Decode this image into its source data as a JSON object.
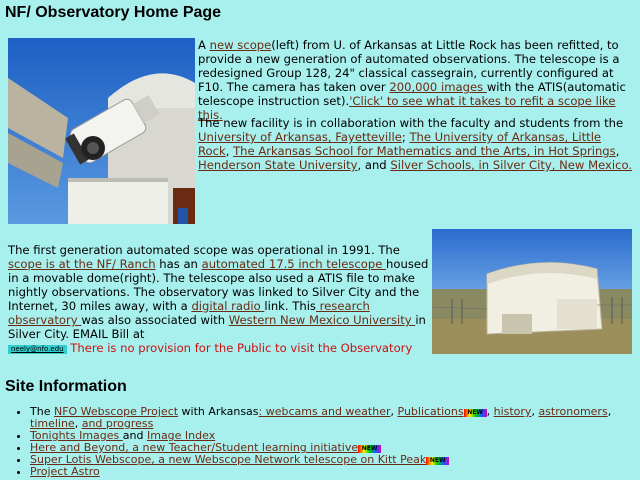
{
  "page": {
    "title": "NF/ Observatory Home Page",
    "accent": "#6b2a12",
    "background": "#a8f0ee",
    "alert_color": "#cc1111"
  },
  "intro": {
    "p1_a": "A ",
    "p1_link1": "new scope",
    "p1_b": "(left) from U. of Arkansas at Little Rock has been refitted, to provide a new generation of automated observations. The telescope is a redesigned Group 128, 24\" classical cassegrain, currently configured at F10. The camera has taken over ",
    "p1_link2": "200,000 images ",
    "p1_c": "with the ATIS(automatic telescope instruction set).",
    "p1_link3": "'Click' to see what it takes to refit a scope like this.",
    "p2_a": "The new facility is in collaboration with the faculty and students from the ",
    "p2_link1": "University of Arkansas, Fayetteville",
    "p2_sep1": "; ",
    "p2_link2": "The University of Arkansas, Little Rock",
    "p2_sep2": ", ",
    "p2_link3": "The Arkansas School for Mathematics and the Arts, in Hot Springs",
    "p2_sep3": ", ",
    "p2_link4": "Henderson State University",
    "p2_sep4": ", and ",
    "p2_link5": "Silver Schools, in Silver City, New Mexico."
  },
  "history": {
    "a": "The first generation automated scope was operational in 1991. The",
    "link1": " scope is at the NF/ Ranch",
    "b": " has an ",
    "link2": "automated 17.5 inch telescope ",
    "c": "housed in a movable dome(right). The telescope also used a ATIS file to make nightly observations. The observatory was linked to Silver City and the Internet, 30 miles away, with a ",
    "link3": "digital radio ",
    "d": "link. This",
    "link4": " research observatory ",
    "e": "was also associated with ",
    "link5": "Western New Mexico University ",
    "f": "in Silver City. EMAIL Bill at",
    "email": "neely@nfo.edu",
    "no_public": "There is no provision for the Public to visit the Observatory"
  },
  "site_info": {
    "heading": "Site Information",
    "new_badge": "NEW",
    "item1": {
      "a": "The ",
      "link1": "NFO Webscope Project",
      "b": " with Arkansas",
      "link2": ": webcams and weather",
      "c": ", ",
      "link3": "Publications",
      "d": ", ",
      "link4": "history",
      "e": ", ",
      "link5": "astronomers",
      "f": ", ",
      "link6": "timeline",
      "g": ", ",
      "link7": "and progress"
    },
    "item2": {
      "link1": "Tonights Images ",
      "a": "and ",
      "link2": "Image Index"
    },
    "item3": {
      "link1": "Here and Beyond, a new Teacher/Student learning initiative"
    },
    "item4": {
      "link1": "Super Lotis Webscope, a new Webscope Network telescope on Kitt Peak"
    },
    "item5": {
      "link1": "Project Astro"
    }
  }
}
